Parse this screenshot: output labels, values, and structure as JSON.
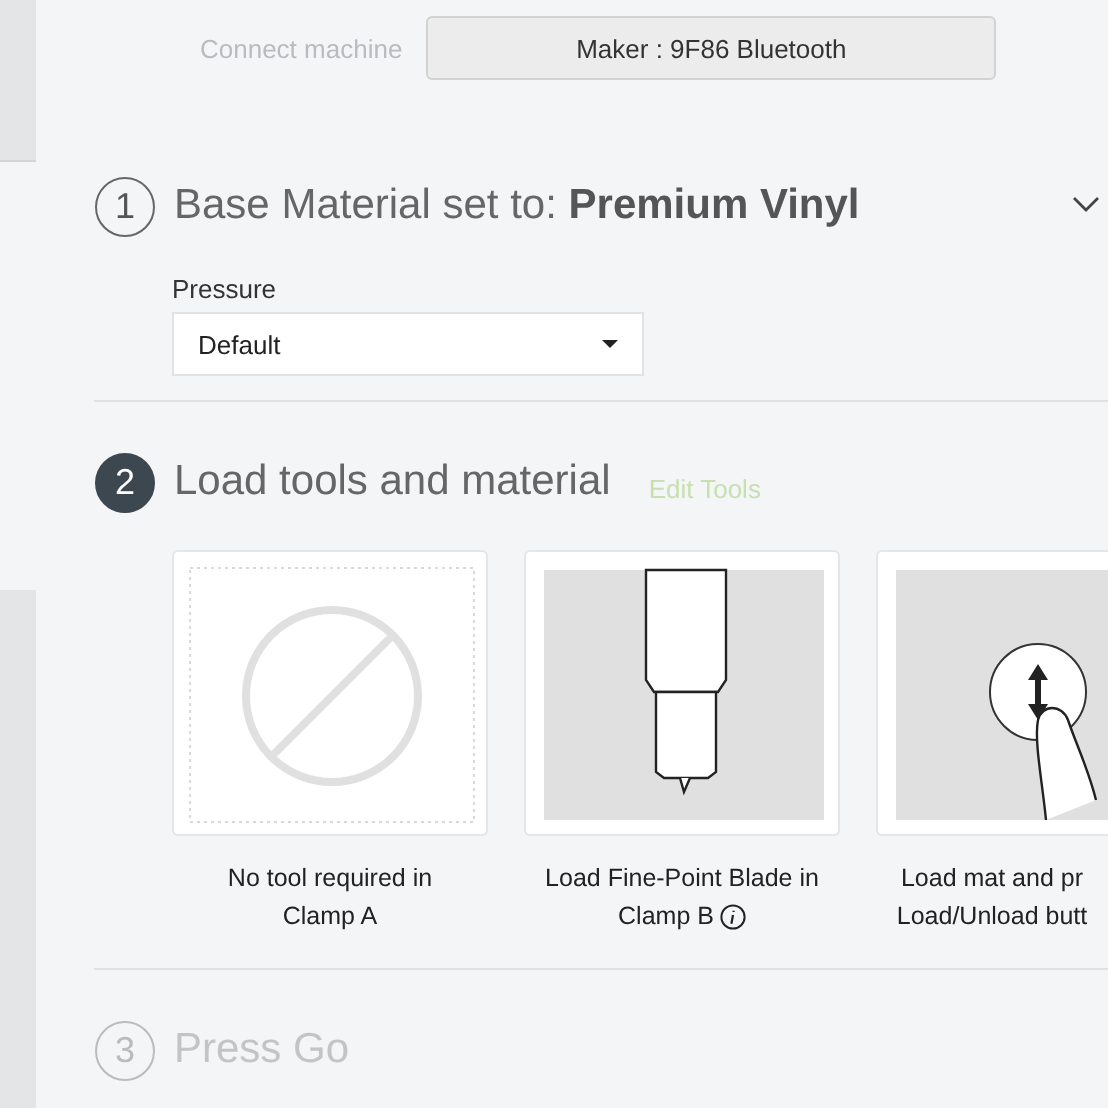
{
  "connect": {
    "label": "Connect machine",
    "machine": "Maker : 9F86 Bluetooth"
  },
  "steps": [
    {
      "number": "1",
      "active": false,
      "disabled": false,
      "title": "Base Material set to: **Premium Vinyl**",
      "expanded": false,
      "pressure": {
        "label": "Pressure",
        "value": "Default"
      }
    },
    {
      "number": "2",
      "active": true,
      "disabled": false,
      "title": "Load tools and material",
      "link": "Edit Tools",
      "cards": [
        {
          "kind": "none",
          "lines": [
            "No tool required in",
            "Clamp A"
          ],
          "info": false
        },
        {
          "kind": "blade",
          "lines": [
            "Load Fine-Point Blade in",
            "Clamp B"
          ],
          "info": true
        },
        {
          "kind": "press",
          "lines": [
            "Load mat and pr",
            "Load/Unload butt"
          ],
          "info": false
        }
      ]
    },
    {
      "number": "3",
      "active": false,
      "disabled": true,
      "title": "Press Go"
    }
  ]
}
